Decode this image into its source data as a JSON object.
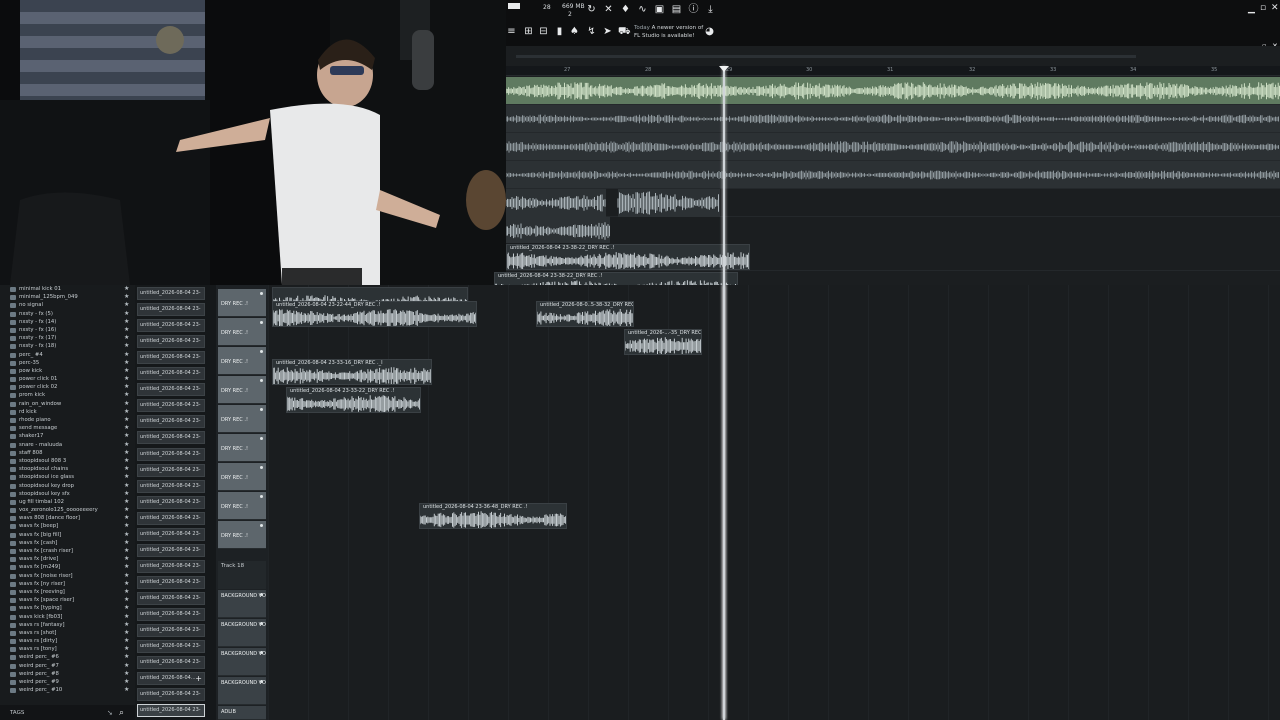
{
  "toolbar": {
    "tempo_top": "28",
    "tempo_bottom": "",
    "memory": "669 MB",
    "cpu_count": "2",
    "news_today": "Today",
    "news_line1": "A newer version of",
    "news_line2": "FL Studio is available!"
  },
  "ruler": {
    "bars": [
      "27",
      "28",
      "29",
      "30",
      "31",
      "32",
      "33",
      "34",
      "35"
    ]
  },
  "browser": {
    "items": [
      "minimal kick 01",
      "minimal_125bpm_049",
      "no signal",
      "nxsty - fx (5)",
      "nxsty - fx (14)",
      "nxsty - fx (16)",
      "nxsty - fx (17)",
      "nxsty - fx (18)",
      "perc_ #4",
      "perc-35",
      "pow kick",
      "power click 01",
      "power click 02",
      "prom kick",
      "rain_on_window",
      "rd kick",
      "rhode piano",
      "send message",
      "shaker17",
      "snare - maluuda",
      "staff 808",
      "stoopidsoul 808 3",
      "stoopidsoul chains",
      "stoopidsoul ice glass",
      "stoopidsoul key drop",
      "stoopidsoul key sfx",
      "ug fill timbal 102",
      "vox_zeronolo125_ooooeeeery",
      "wavs 808 [dance floor]",
      "wavs fx [beep]",
      "wavs fx [big fill]",
      "wavs fx [cash]",
      "wavs fx [crash riser]",
      "wavs fx [drive]",
      "wavs fx [m249]",
      "wavs fx [noise riser]",
      "wavs fx [ny riser]",
      "wavs fx [reeving]",
      "wavs fx [space riser]",
      "wavs fx [typing]",
      "wavs kick [fb03]",
      "wavs rs [fantasy]",
      "wavs rs [shot]",
      "wavs rs [dirty]",
      "wavs rs [tony]",
      "weird perc_ #6",
      "weird perc_ #7",
      "weird perc_ #8",
      "weird perc_ #9",
      "weird perc_ #10"
    ],
    "tags_label": "TAGS"
  },
  "clips": {
    "label": "untitled_2026-08-04 23-",
    "selected_label": "untitled_2026-08-04...",
    "last_label": "untitled_2026-08-04 23-"
  },
  "tracks": {
    "dry_rec": "DRY REC .!",
    "track18": "Track 18",
    "background_vocal": "BACKGROUND VOCAL",
    "adlib": "ADLIB"
  },
  "audio_clips": [
    {
      "title": "untitled_2026-08-04 23-38-22_DRY REC .!"
    },
    {
      "title": "untitled_2026-08-04 23-38-22_DRY REC .!"
    },
    {
      "title": "untitled_2026-08-04 23-22-44_DRY REC .!"
    },
    {
      "title": "untitled_2026-08-0..5-38-32_DRY REC .!"
    },
    {
      "title": "untitled_2026-...-35_DRY REC .!"
    },
    {
      "title": "untitled_2026-08-04 23-33-16_DRY REC ._I"
    },
    {
      "title": "untitled_2026-08-04 23-33-22_DRY REC .!"
    },
    {
      "title": "untitled_2026-08-04 23-36-48_DRY REC .!"
    }
  ],
  "colors": {
    "bg": "#0e1011",
    "playlist": "#1b1e20",
    "track_header": "#5d666c",
    "waveform_active": "#cfe0c6",
    "waveform_dim": "#8e989d"
  }
}
